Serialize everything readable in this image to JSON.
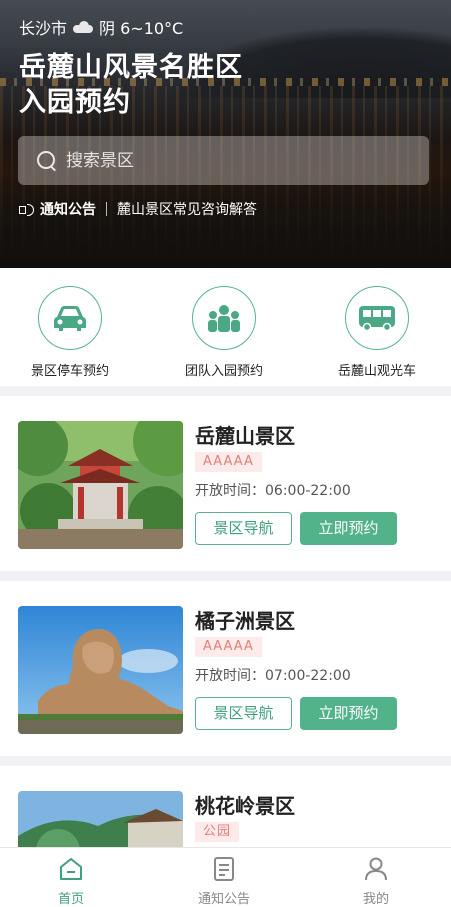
{
  "header": {
    "city": "长沙市",
    "weather_icon": "cloudy-icon",
    "weather_text": "阴 6~10°C",
    "title_line1": "岳麓山风景名胜区",
    "title_line2": "入园预约"
  },
  "search": {
    "placeholder": "搜索景区"
  },
  "notice": {
    "label": "通知公告",
    "text": "麓山景区常见咨询解答"
  },
  "entries": [
    {
      "label": "景区停车预约",
      "icon": "car-icon"
    },
    {
      "label": "团队入园预约",
      "icon": "group-icon"
    },
    {
      "label": "岳麓山观光车",
      "icon": "bus-icon"
    }
  ],
  "scenic_spots": [
    {
      "name": "岳麓山景区",
      "badge": "AAAAA",
      "hours": "开放时间：06:00-22:00",
      "nav_label": "景区导航",
      "book_label": "立即预约"
    },
    {
      "name": "橘子洲景区",
      "badge": "AAAAA",
      "hours": "开放时间：07:00-22:00",
      "nav_label": "景区导航",
      "book_label": "立即预约"
    },
    {
      "name": "桃花岭景区",
      "badge": "公园"
    }
  ],
  "tabbar": [
    {
      "label": "首页",
      "icon": "home-icon",
      "active": true
    },
    {
      "label": "通知公告",
      "icon": "document-icon",
      "active": false
    },
    {
      "label": "我的",
      "icon": "user-icon",
      "active": false
    }
  ],
  "colors": {
    "accent": "#52b38a",
    "badge_bg": "#fcebea",
    "badge_text": "#e0807a"
  }
}
